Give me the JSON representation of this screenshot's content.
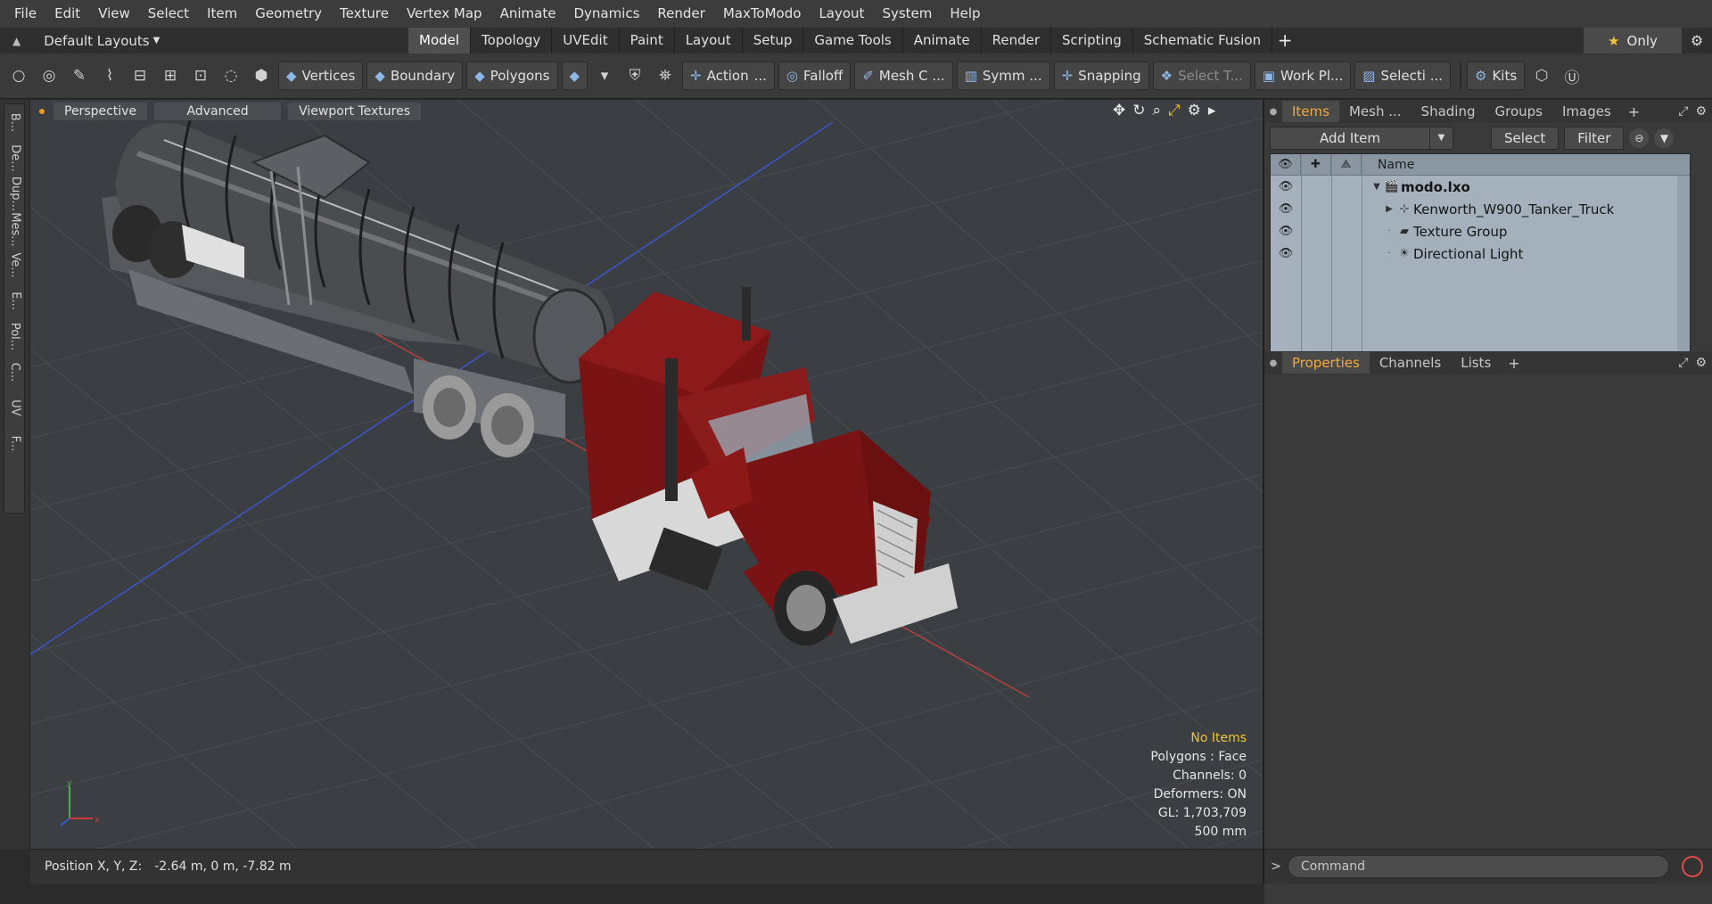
{
  "menu": [
    "File",
    "Edit",
    "View",
    "Select",
    "Item",
    "Geometry",
    "Texture",
    "Vertex Map",
    "Animate",
    "Dynamics",
    "Render",
    "MaxToModo",
    "Layout",
    "System",
    "Help"
  ],
  "layout_selector": "Default Layouts",
  "tabs": [
    "Model",
    "Topology",
    "UVEdit",
    "Paint",
    "Layout",
    "Setup",
    "Game Tools",
    "Animate",
    "Render",
    "Scripting",
    "Schematic Fusion"
  ],
  "active_tab": "Model",
  "only_label": "Only",
  "toolbar": {
    "vertices": "Vertices",
    "boundary": "Boundary",
    "polygons": "Polygons",
    "action": "Action",
    "action_more": "...",
    "falloff": "Falloff",
    "mesh_c": "Mesh C ...",
    "symm": "Symm ...",
    "snapping": "Snapping",
    "select_t": "Select T...",
    "work_pl": "Work Pl...",
    "selecti": "Selecti ...",
    "kits": "Kits"
  },
  "left_tabs": [
    "B...",
    "De...",
    "Dup...",
    "Mes...",
    "Ve...",
    "E...",
    "Pol...",
    "C...",
    "UV",
    "F..."
  ],
  "viewport": {
    "view_mode": "Perspective",
    "shading": "Advanced",
    "textures": "Viewport Textures",
    "info": {
      "selection": "No Items",
      "polygons": "Polygons : Face",
      "channels": "Channels: 0",
      "deformers": "Deformers: ON",
      "gl": "GL: 1,703,709",
      "grid": "500 mm"
    }
  },
  "status": {
    "position_label": "Position X, Y, Z:",
    "position_value": "-2.64 m, 0 m, -7.82 m"
  },
  "items_panel": {
    "tabs": [
      "Items",
      "Mesh ...",
      "Shading",
      "Groups",
      "Images"
    ],
    "active_tab": "Items",
    "add_item": "Add Item",
    "select": "Select",
    "filter": "Filter",
    "column_name": "Name",
    "rows": [
      {
        "name": "modo.lxo",
        "icon": "scene-icon"
      },
      {
        "name": "Kenworth_W900_Tanker_Truck",
        "icon": "locator-icon"
      },
      {
        "name": "Texture Group",
        "icon": "folder-icon"
      },
      {
        "name": "Directional Light",
        "icon": "light-icon"
      }
    ]
  },
  "props_panel": {
    "tabs": [
      "Properties",
      "Channels",
      "Lists"
    ],
    "active_tab": "Properties"
  },
  "command": {
    "placeholder": "Command"
  },
  "colors": {
    "accent": "#f2a93b",
    "truck_red": "#7a1414",
    "tank_gray": "#4a4d50",
    "viewport_bg": "#3b3f44",
    "list_bg": "#a4b0bc"
  }
}
